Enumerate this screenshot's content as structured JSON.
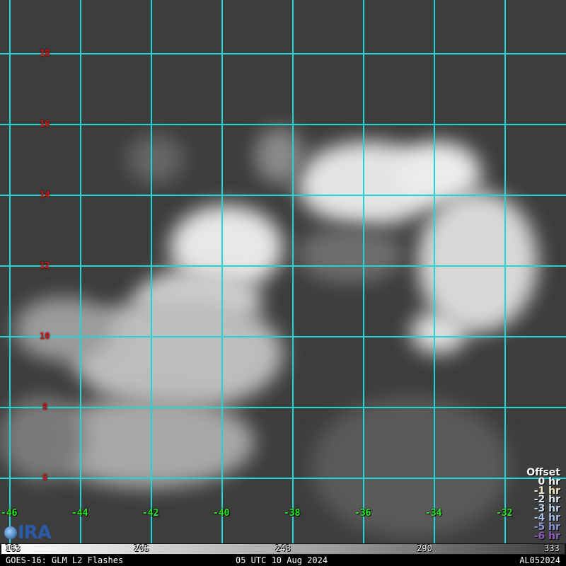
{
  "map": {
    "latitude_labels": [
      "18",
      "16",
      "14",
      "12",
      "10",
      "8",
      "6"
    ],
    "longitude_labels": [
      "-46",
      "-44",
      "-42",
      "-40",
      "-38",
      "-36",
      "-34",
      "-32"
    ],
    "gridline_color": "#1fd6d6"
  },
  "legend": {
    "title": "Offset",
    "items": [
      {
        "label": "0 hr",
        "color": "#ffffff"
      },
      {
        "label": "-1 hr",
        "color": "#f4f0c8"
      },
      {
        "label": "-2 hr",
        "color": "#dce8ee"
      },
      {
        "label": "-3 hr",
        "color": "#c0d4ea"
      },
      {
        "label": "-4 hr",
        "color": "#a8c0e6"
      },
      {
        "label": "-5 hr",
        "color": "#8c98d8"
      },
      {
        "label": "-6 hr",
        "color": "#8a5cb8"
      }
    ]
  },
  "logo": {
    "text": "CIRA"
  },
  "colorbar": {
    "ticks": [
      "163",
      "205",
      "248",
      "290",
      "333"
    ]
  },
  "footer": {
    "product": "GOES-16: GLM L2 Flashes",
    "time": "05 UTC 10 Aug 2024",
    "storm_id": "AL052024"
  }
}
